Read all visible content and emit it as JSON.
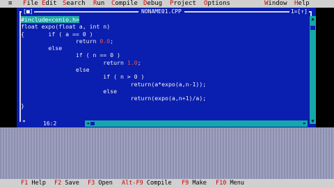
{
  "menubar": {
    "system": "≡",
    "items": [
      {
        "hot": "F",
        "rest": "ile"
      },
      {
        "hot": "E",
        "rest": "dit"
      },
      {
        "hot": "S",
        "rest": "earch"
      },
      {
        "hot": "R",
        "rest": "un"
      },
      {
        "hot": "C",
        "rest": "ompile"
      },
      {
        "hot": "D",
        "rest": "ebug"
      },
      {
        "hot": "P",
        "rest": "roject"
      },
      {
        "hot": "O",
        "rest": "ptions"
      },
      {
        "hot": "W",
        "rest": "indow"
      },
      {
        "hot": "H",
        "rest": "elp"
      }
    ]
  },
  "window": {
    "close_box": "[■]",
    "title": "NONAME01.CPP",
    "number": "1=[↑]",
    "status_marker": "*",
    "cursor_pos": "16:2"
  },
  "code_lines": [
    [
      {
        "t": "#include<conio.h>",
        "c": "sel"
      }
    ],
    [
      {
        "t": "float expo(float a, int n)"
      }
    ],
    [
      {
        "t": "{       if ( a == 0 )"
      }
    ],
    [
      {
        "t": "                return "
      },
      {
        "t": "0.0",
        "c": "num"
      },
      {
        "t": ";"
      }
    ],
    [
      {
        "t": "        else"
      }
    ],
    [
      {
        "t": "                if ( n == 0 )"
      }
    ],
    [
      {
        "t": "                        return "
      },
      {
        "t": "1.0",
        "c": "num"
      },
      {
        "t": ";"
      }
    ],
    [
      {
        "t": "                else"
      }
    ],
    [
      {
        "t": "                        if ( n > 0 )"
      }
    ],
    [
      {
        "t": "                                return(a*expo(a,n-1));"
      }
    ],
    [
      {
        "t": "                        else"
      }
    ],
    [
      {
        "t": "                                return(expo(a,n+1)/a);"
      }
    ],
    [
      {
        "t": "}"
      }
    ]
  ],
  "statusbar": [
    {
      "key": "F1",
      "label": " Help"
    },
    {
      "key": "F2",
      "label": " Save"
    },
    {
      "key": "F3",
      "label": " Open"
    },
    {
      "key": "Alt-F9",
      "label": " Compile"
    },
    {
      "key": "F9",
      "label": " Make"
    },
    {
      "key": "F10",
      "label": " Menu"
    }
  ],
  "colors": {
    "editor_bg": "#0a1eb0",
    "menubar_bg": "#cfd0cf",
    "hotkey": "#d00000",
    "number_literal": "#e25757",
    "selection": "#20a8a8"
  }
}
